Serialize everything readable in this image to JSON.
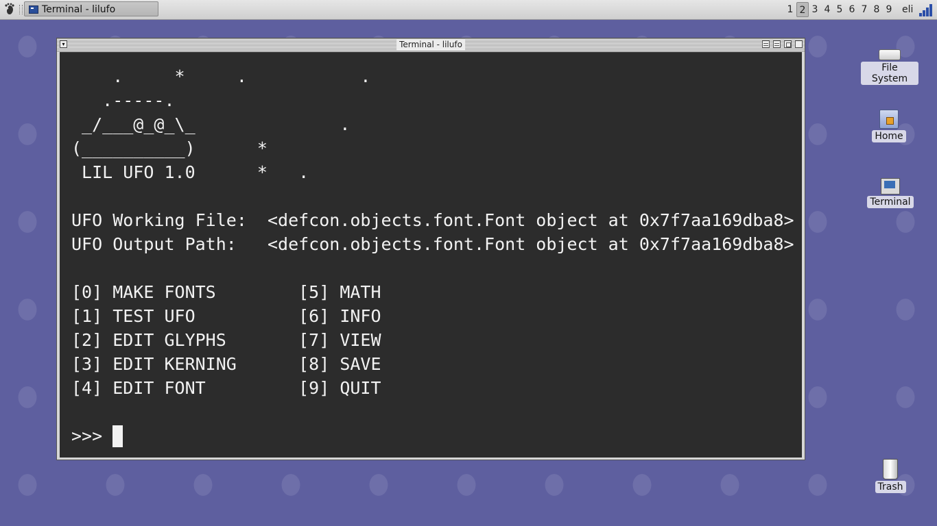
{
  "panel": {
    "task_title": "Terminal - lilufo",
    "workspaces": [
      "1",
      "2",
      "3",
      "4",
      "5",
      "6",
      "7",
      "8",
      "9"
    ],
    "active_workspace": "2",
    "user": "eli"
  },
  "window": {
    "title": "Terminal - lilufo"
  },
  "terminal": {
    "lines": [
      "    .     *     .           .",
      "   .-----.",
      " _/___@_@_\\_              .",
      "(__________)      *",
      " LIL UFO 1.0      *   .",
      "",
      "UFO Working File:  <defcon.objects.font.Font object at 0x7f7aa169dba8>",
      "UFO Output Path:   <defcon.objects.font.Font object at 0x7f7aa169dba8>",
      "",
      "[0] MAKE FONTS        [5] MATH",
      "[1] TEST UFO          [6] INFO",
      "[2] EDIT GLYPHS       [7] VIEW",
      "[3] EDIT KERNING      [8] SAVE",
      "[4] EDIT FONT         [9] QUIT",
      ""
    ],
    "prompt": ">>> "
  },
  "desktop_icons": {
    "file_system": "File System",
    "home": "Home",
    "terminal": "Terminal",
    "trash": "Trash"
  },
  "colors": {
    "desktop": "#5e5f9f",
    "terminal_bg": "#2c2c2c",
    "terminal_fg": "#f2f2f2"
  }
}
